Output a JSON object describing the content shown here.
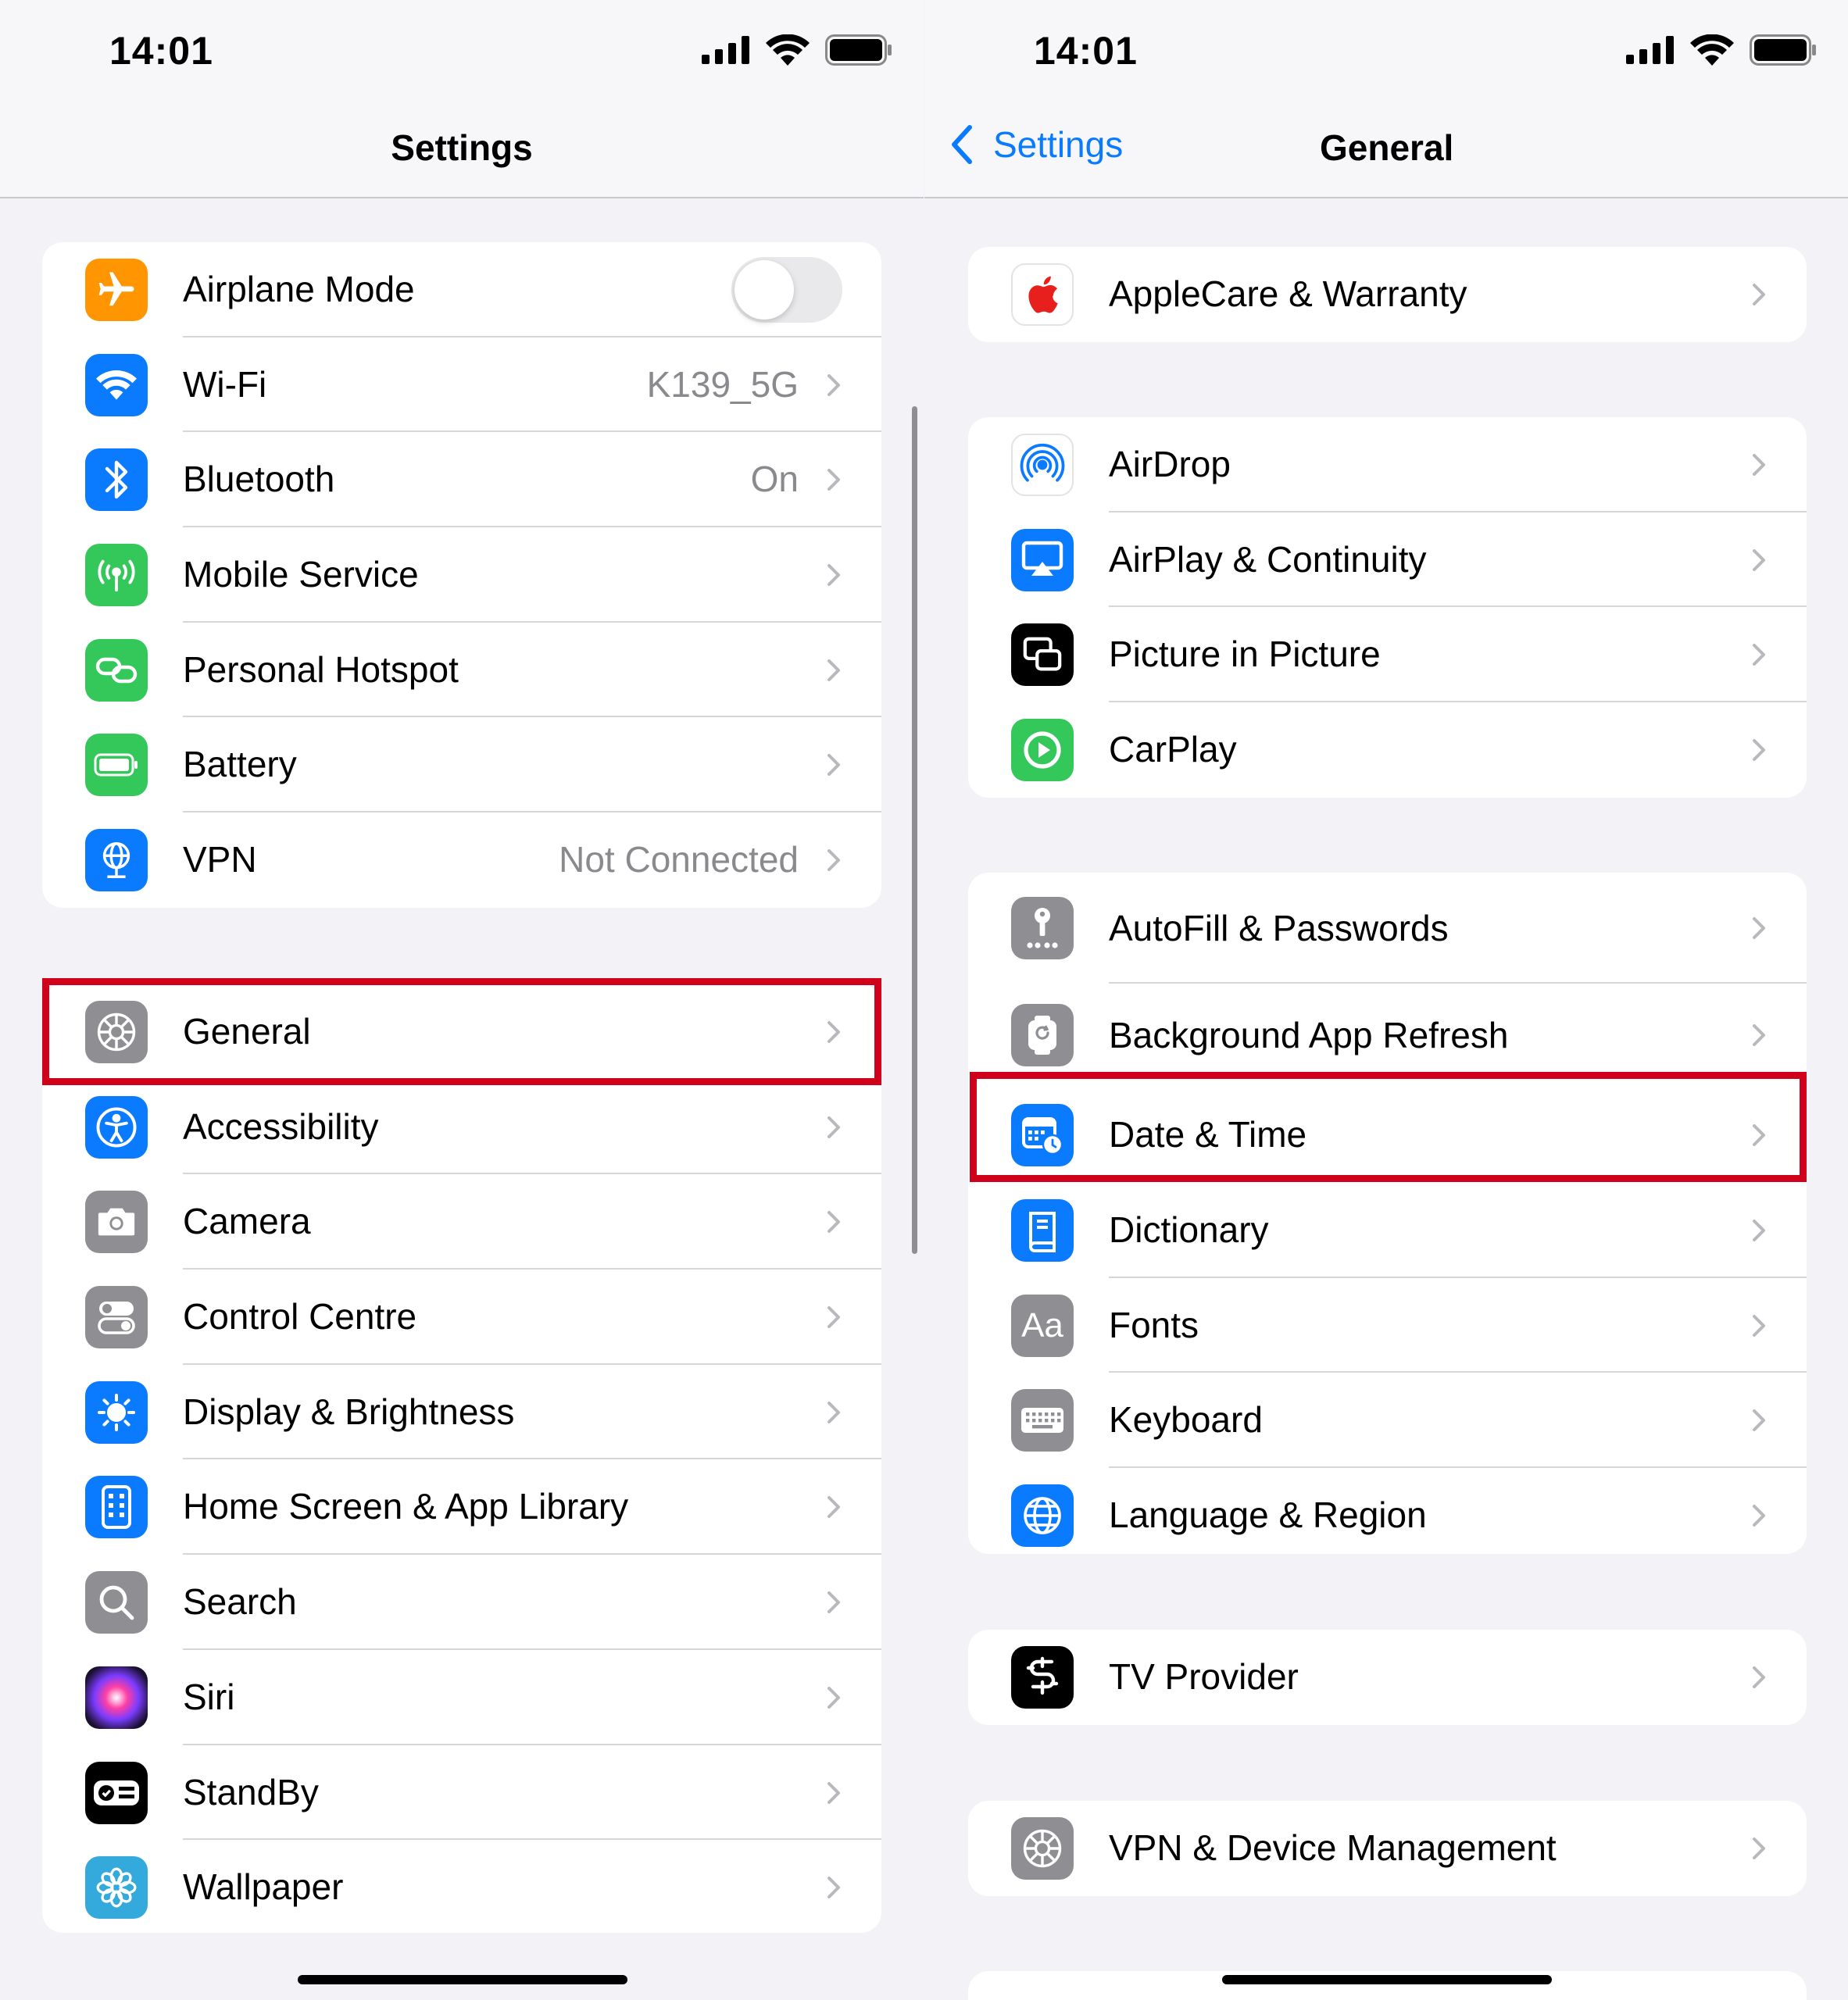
{
  "left": {
    "status": {
      "time": "14:01"
    },
    "nav": {
      "title": "Settings"
    },
    "group1": [
      {
        "label": "Airplane Mode",
        "icon": "airplane-icon",
        "color": "#ff9500",
        "toggle": false
      },
      {
        "label": "Wi-Fi",
        "value": "K139_5G",
        "icon": "wifi-icon",
        "color": "#0a7aff"
      },
      {
        "label": "Bluetooth",
        "value": "On",
        "icon": "bluetooth-icon",
        "color": "#0a7aff"
      },
      {
        "label": "Mobile Service",
        "icon": "antenna-icon",
        "color": "#34c759"
      },
      {
        "label": "Personal Hotspot",
        "icon": "hotspot-link-icon",
        "color": "#34c759"
      },
      {
        "label": "Battery",
        "icon": "battery-icon",
        "color": "#34c759"
      },
      {
        "label": "VPN",
        "value": "Not Connected",
        "icon": "vpn-globe-icon",
        "color": "#0a7aff"
      }
    ],
    "group2": [
      {
        "label": "General",
        "icon": "gear-icon",
        "color": "#8e8e93",
        "highlighted": true
      },
      {
        "label": "Accessibility",
        "icon": "accessibility-icon",
        "color": "#0a7aff"
      },
      {
        "label": "Camera",
        "icon": "camera-icon",
        "color": "#8e8e93"
      },
      {
        "label": "Control Centre",
        "icon": "toggles-icon",
        "color": "#8e8e93"
      },
      {
        "label": "Display & Brightness",
        "icon": "sun-icon",
        "color": "#0a7aff"
      },
      {
        "label": "Home Screen & App Library",
        "icon": "phone-grid-icon",
        "color": "#0a7aff"
      },
      {
        "label": "Search",
        "icon": "magnifier-icon",
        "color": "#8e8e93"
      },
      {
        "label": "Siri",
        "icon": "siri-icon",
        "color": "#3a0e4a"
      },
      {
        "label": "StandBy",
        "icon": "standby-icon",
        "color": "#000000"
      },
      {
        "label": "Wallpaper",
        "icon": "flower-icon",
        "color": "#34aadc"
      }
    ]
  },
  "right": {
    "status": {
      "time": "14:01"
    },
    "nav": {
      "back_label": "Settings",
      "title": "General"
    },
    "group1": [
      {
        "label": "AppleCare & Warranty",
        "icon": "apple-logo-icon",
        "color": "#ffffff"
      }
    ],
    "group2": [
      {
        "label": "AirDrop",
        "icon": "airdrop-icon",
        "color": "#ffffff"
      },
      {
        "label": "AirPlay & Continuity",
        "icon": "airplay-icon",
        "color": "#0a7aff"
      },
      {
        "label": "Picture in Picture",
        "icon": "pip-icon",
        "color": "#000000"
      },
      {
        "label": "CarPlay",
        "icon": "carplay-icon",
        "color": "#34c759"
      }
    ],
    "group3": [
      {
        "label": "AutoFill & Passwords",
        "icon": "key-icon",
        "color": "#8e8e93"
      },
      {
        "label": "Background App Refresh",
        "icon": "refresh-icon",
        "color": "#8e8e93"
      },
      {
        "label": "Date & Time",
        "icon": "calendar-clock-icon",
        "color": "#0a7aff",
        "highlighted": true
      },
      {
        "label": "Dictionary",
        "icon": "book-icon",
        "color": "#0a7aff"
      },
      {
        "label": "Fonts",
        "icon": "fonts-aa-icon",
        "color": "#8e8e93",
        "icon_text": "Aa"
      },
      {
        "label": "Keyboard",
        "icon": "keyboard-icon",
        "color": "#8e8e93"
      },
      {
        "label": "Language & Region",
        "icon": "globe-icon",
        "color": "#0a7aff"
      }
    ],
    "group4": [
      {
        "label": "TV Provider",
        "icon": "tv-provider-icon",
        "color": "#000000"
      }
    ],
    "group5": [
      {
        "label": "VPN & Device Management",
        "icon": "gear-icon",
        "color": "#8e8e93"
      }
    ]
  },
  "colors": {
    "accent": "#0a7aff",
    "highlight": "#d0021b",
    "background": "#f2f2f7"
  }
}
